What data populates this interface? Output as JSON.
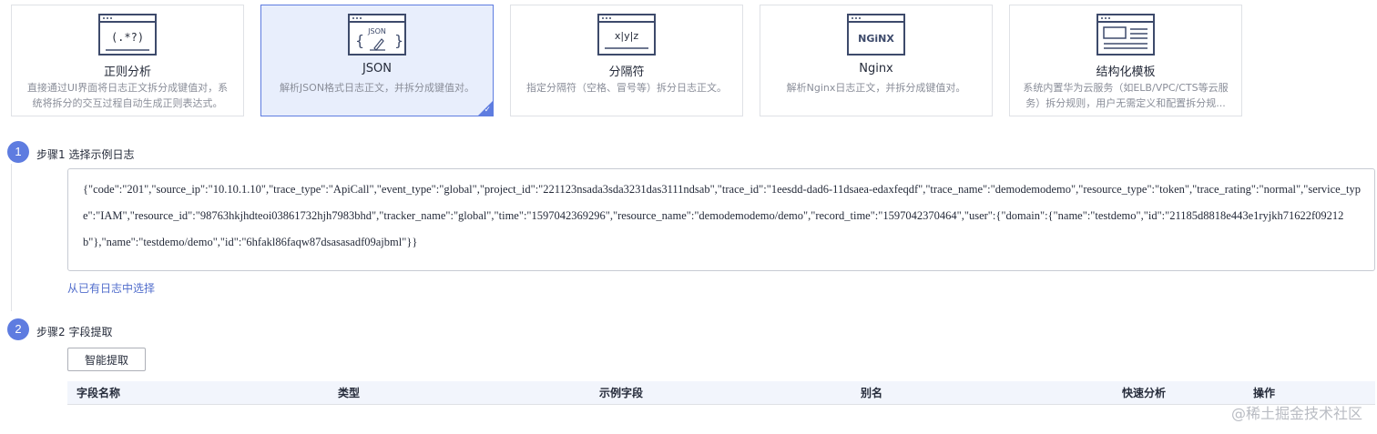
{
  "cards": [
    {
      "icon": "regex-icon",
      "icon_text": "(.*?)",
      "title": "正则分析",
      "desc": "直接通过UI界面将日志正文拆分成键值对，系统将拆分的交互过程自动生成正则表达式。",
      "selected": false
    },
    {
      "icon": "json-icon",
      "icon_text": "JSON",
      "title": "JSON",
      "desc": "解析JSON格式日志正文，并拆分成键值对。",
      "selected": true
    },
    {
      "icon": "delimiter-icon",
      "icon_text": "x|y|z",
      "title": "分隔符",
      "desc": "指定分隔符（空格、冒号等）拆分日志正文。",
      "selected": false
    },
    {
      "icon": "nginx-icon",
      "icon_text": "NGiNX",
      "title": "Nginx",
      "desc": "解析Nginx日志正文，并拆分成键值对。",
      "selected": false
    },
    {
      "icon": "template-icon",
      "icon_text": "",
      "title": "结构化模板",
      "desc": "系统内置华为云服务（如ELB/VPC/CTS等云服务）拆分规则，用户无需定义和配置拆分规...",
      "selected": false
    }
  ],
  "step1": {
    "number": "1",
    "title": "步骤1 选择示例日志",
    "log": "{\"code\":\"201\",\"source_ip\":\"10.10.1.10\",\"trace_type\":\"ApiCall\",\"event_type\":\"global\",\"project_id\":\"221123nsada3sda3231das3111ndsab\",\"trace_id\":\"1eesdd-dad6-11dsaea-edaxfeqdf\",\"trace_name\":\"demodemodemo\",\"resource_type\":\"token\",\"trace_rating\":\"normal\",\"service_type\":\"IAM\",\"resource_id\":\"98763hkjhdteoi03861732hjh7983bhd\",\"tracker_name\":\"global\",\"time\":\"1597042369296\",\"resource_name\":\"demodemodemo/demo\",\"record_time\":\"1597042370464\",\"user\":{\"domain\":{\"name\":\"testdemo\",\"id\":\"21185d8818e443e1ryjkh71622f09212b\"},\"name\":\"testdemo/demo\",\"id\":\"6hfakl86faqw87dsasasadf09ajbml\"}}",
    "link": "从已有日志中选择"
  },
  "step2": {
    "number": "2",
    "title": "步骤2 字段提取",
    "button": "智能提取",
    "columns": [
      "字段名称",
      "类型",
      "示例字段",
      "别名",
      "快速分析",
      "操作"
    ]
  },
  "watermark": "@稀土掘金技术社区",
  "colors": {
    "accent": "#5e7ce0",
    "link": "#526ecc",
    "card_selected_bg": "#e8eefc",
    "table_head_bg": "#f2f5fc"
  }
}
